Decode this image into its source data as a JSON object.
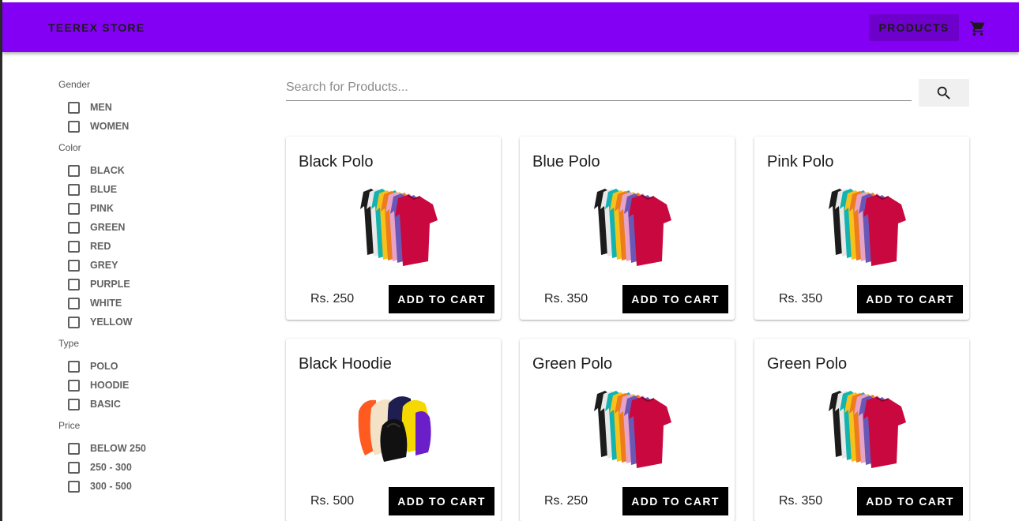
{
  "header": {
    "brand": "TEEREX STORE",
    "products_label": "PRODUCTS",
    "cart_icon": "shopping-cart-icon",
    "bar_color": "#8400f5"
  },
  "search": {
    "placeholder": "Search for Products...",
    "value": "",
    "button_icon": "search-icon"
  },
  "filters": [
    {
      "heading": "Gender",
      "options": [
        "MEN",
        "WOMEN"
      ]
    },
    {
      "heading": "Color",
      "options": [
        "BLACK",
        "BLUE",
        "PINK",
        "GREEN",
        "RED",
        "GREY",
        "PURPLE",
        "WHITE",
        "YELLOW"
      ]
    },
    {
      "heading": "Type",
      "options": [
        "POLO",
        "HOODIE",
        "BASIC"
      ]
    },
    {
      "heading": "Price",
      "options": [
        "BELOW 250",
        "250 - 300",
        "300 - 500"
      ]
    }
  ],
  "products": [
    {
      "name": "Black Polo",
      "price": "Rs. 250",
      "image": "polo-shirts-image",
      "button": "ADD TO CART"
    },
    {
      "name": "Blue Polo",
      "price": "Rs. 350",
      "image": "polo-shirts-image",
      "button": "ADD TO CART"
    },
    {
      "name": "Pink Polo",
      "price": "Rs. 350",
      "image": "polo-shirts-image",
      "button": "ADD TO CART"
    },
    {
      "name": "Black Hoodie",
      "price": "Rs. 500",
      "image": "hoodies-image",
      "button": "ADD TO CART"
    },
    {
      "name": "Green Polo",
      "price": "Rs. 250",
      "image": "polo-shirts-image",
      "button": "ADD TO CART"
    },
    {
      "name": "Green Polo",
      "price": "Rs. 350",
      "image": "polo-shirts-image",
      "button": "ADD TO CART"
    }
  ]
}
